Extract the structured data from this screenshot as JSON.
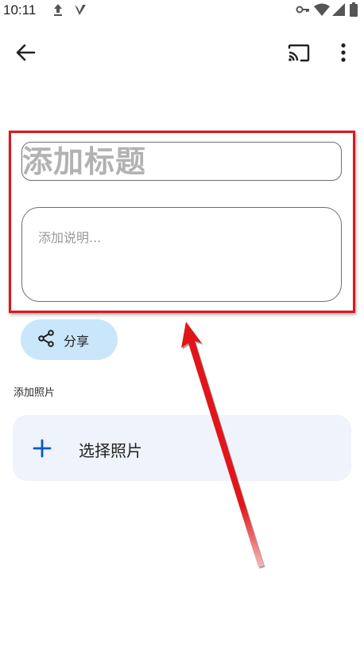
{
  "status_bar": {
    "time": "10:11",
    "left_icons": [
      "upload-icon",
      "check-v-icon"
    ],
    "right_icons": [
      "vpn-key-icon",
      "wifi-icon",
      "signal-icon",
      "battery-icon"
    ]
  },
  "app_bar": {
    "back_icon": "back-arrow-icon",
    "cast_icon": "cast-icon",
    "more_icon": "more-vert-icon"
  },
  "form": {
    "title_placeholder": "添加标题",
    "description_placeholder": "添加说明..."
  },
  "share": {
    "label": "分享",
    "icon": "share-icon",
    "color": "#c9e6fb"
  },
  "photos": {
    "section_label": "添加照片",
    "select_label": "选择照片",
    "icon": "plus-icon",
    "plus_color": "#0b57d0"
  },
  "annotation": {
    "color": "#e0161b"
  }
}
